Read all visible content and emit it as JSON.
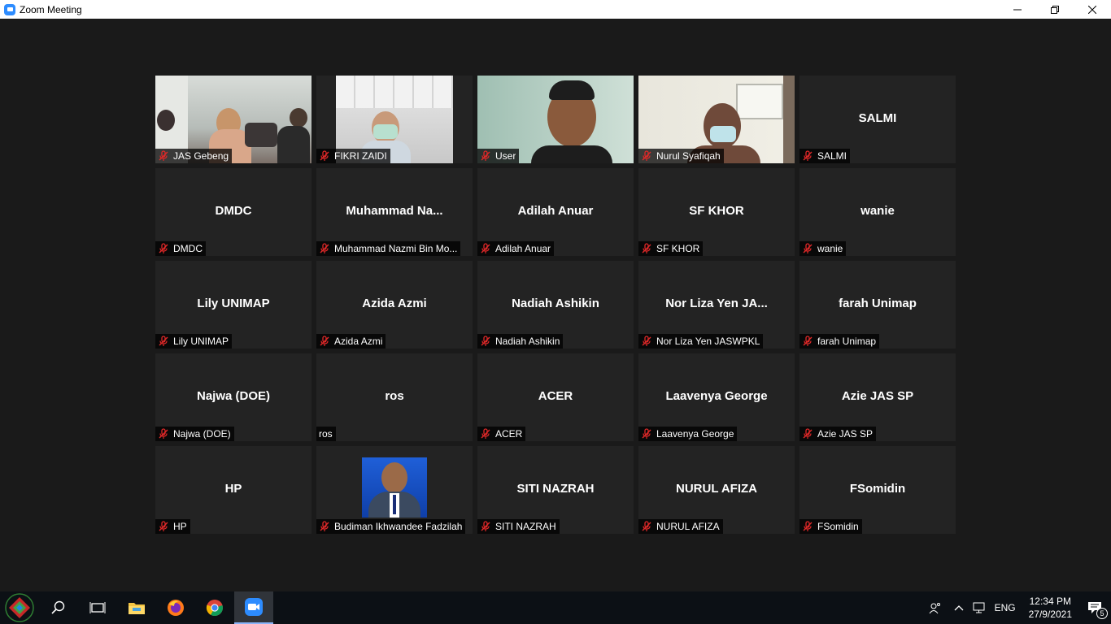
{
  "window": {
    "title": "Zoom Meeting"
  },
  "tiles": [
    {
      "big": "",
      "label": "JAS Gebeng",
      "muted": true,
      "video": "group"
    },
    {
      "big": "",
      "label": "FIKRI ZAIDI",
      "muted": true,
      "video": "office-mask"
    },
    {
      "big": "",
      "label": "User",
      "muted": true,
      "video": "man"
    },
    {
      "big": "",
      "label": "Nurul Syafiqah",
      "muted": true,
      "video": "woman-mask"
    },
    {
      "big": "SALMI",
      "label": "SALMI",
      "muted": true
    },
    {
      "big": "DMDC",
      "label": "DMDC",
      "muted": true
    },
    {
      "big": "Muhammad  Na...",
      "label": "Muhammad Nazmi Bin Mo...",
      "muted": true
    },
    {
      "big": "Adilah Anuar",
      "label": "Adilah Anuar",
      "muted": true
    },
    {
      "big": "SF KHOR",
      "label": "SF KHOR",
      "muted": true
    },
    {
      "big": "wanie",
      "label": "wanie",
      "muted": true
    },
    {
      "big": "Lily UNIMAP",
      "label": "Lily UNIMAP",
      "muted": true
    },
    {
      "big": "Azida Azmi",
      "label": "Azida Azmi",
      "muted": true
    },
    {
      "big": "Nadiah Ashikin",
      "label": "Nadiah Ashikin",
      "muted": true
    },
    {
      "big": "Nor Liza Yen JA...",
      "label": "Nor Liza Yen JASWPKL",
      "muted": true
    },
    {
      "big": "farah Unimap",
      "label": "farah Unimap",
      "muted": true
    },
    {
      "big": "Najwa (DOE)",
      "label": "Najwa (DOE)",
      "muted": true
    },
    {
      "big": "ros",
      "label": "ros",
      "muted": false
    },
    {
      "big": "ACER",
      "label": "ACER",
      "muted": true
    },
    {
      "big": "Laavenya George",
      "label": "Laavenya George",
      "muted": true
    },
    {
      "big": "Azie JAS SP",
      "label": "Azie JAS SP",
      "muted": true
    },
    {
      "big": "HP",
      "label": "HP",
      "muted": true
    },
    {
      "big": "",
      "label": "Budiman Ikhwandee Fadzilah",
      "muted": true,
      "video": "profile-photo"
    },
    {
      "big": "SITI NAZRAH",
      "label": "SITI NAZRAH",
      "muted": true
    },
    {
      "big": "NURUL AFIZA",
      "label": "NURUL AFIZA",
      "muted": true
    },
    {
      "big": "FSomidin",
      "label": "FSomidin",
      "muted": true
    }
  ],
  "taskbar": {
    "language": "ENG",
    "time": "12:34 PM",
    "date": "27/9/2021",
    "notification_count": "5"
  },
  "colors": {
    "mute_red": "#e02828",
    "zoom_blue": "#2d8cff",
    "tile_bg": "#232323"
  }
}
